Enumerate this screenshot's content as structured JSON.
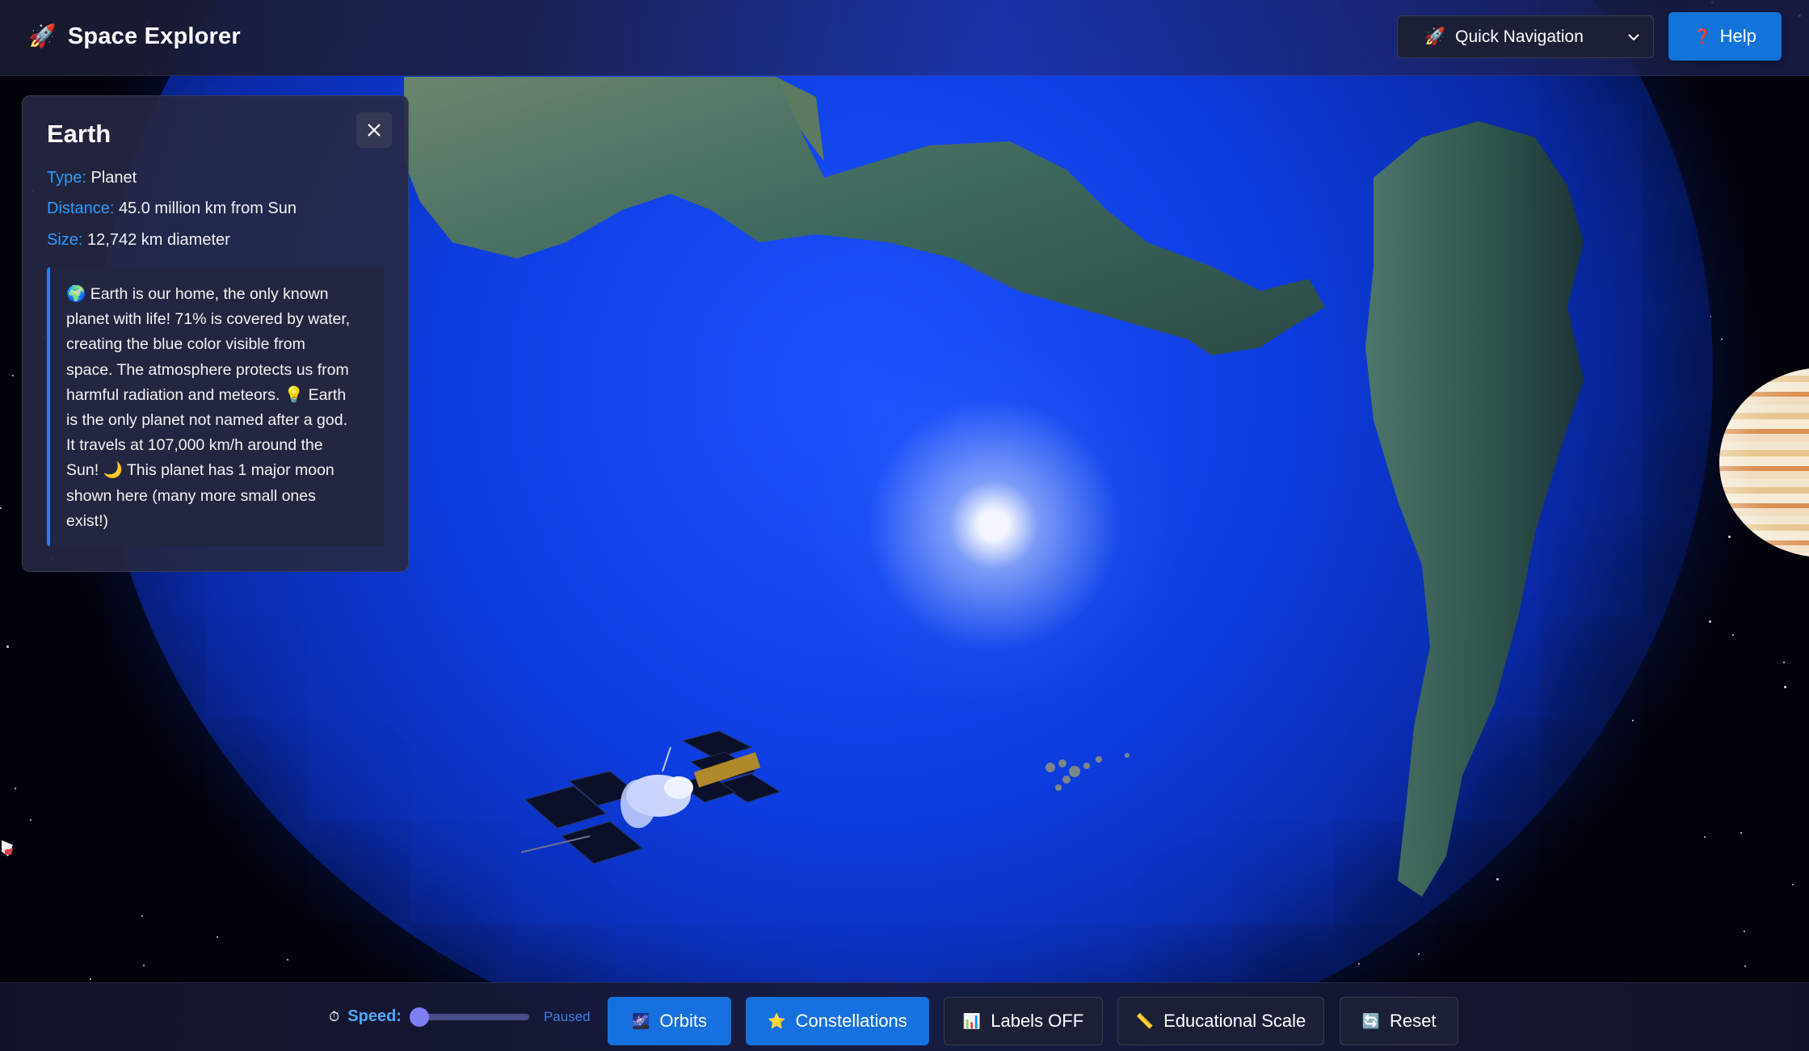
{
  "app": {
    "icon": "rocket-icon",
    "icon_glyph": "🚀",
    "title": "Space Explorer"
  },
  "header": {
    "quick_nav": {
      "icon_glyph": "🚀",
      "label": "Quick Navigation"
    },
    "help": {
      "icon_glyph": "❓",
      "label": "Help"
    }
  },
  "info_panel": {
    "title": "Earth",
    "type_key": "Type:",
    "type_value": "Planet",
    "distance_key": "Distance:",
    "distance_value": "45.0 million km from Sun",
    "size_key": "Size:",
    "size_value": "12,742 km diameter",
    "facts_lines": [
      "🌍 Earth is our home, the only known",
      "planet with life! 71% is covered by water,",
      "creating the blue color visible from",
      "space. The atmosphere protects us from",
      "harmful radiation and meteors. 💡 Earth",
      "is the only planet not named after a god.",
      "It travels at 107,000 km/h around the",
      "Sun! 🌙 This planet has 1 major moon",
      "shown here (many more small ones",
      "exist!)"
    ]
  },
  "controls": {
    "speed": {
      "icon_glyph": "⏱",
      "label": "Speed:",
      "value_fraction": 0.0,
      "status": "Paused"
    },
    "buttons": [
      {
        "icon_glyph": "🌌",
        "label": "Orbits",
        "active": true
      },
      {
        "icon_glyph": "⭐",
        "label": "Constellations",
        "active": true
      },
      {
        "icon_glyph": "📊",
        "label": "Labels OFF",
        "active": false
      },
      {
        "icon_glyph": "📏",
        "label": "Educational Scale",
        "active": false
      },
      {
        "icon_glyph": "🔄",
        "label": "Reset",
        "active": false
      }
    ]
  },
  "colors": {
    "accent": "#1670de",
    "panel_bg": "#262842",
    "ocean": "#0d3de0"
  }
}
